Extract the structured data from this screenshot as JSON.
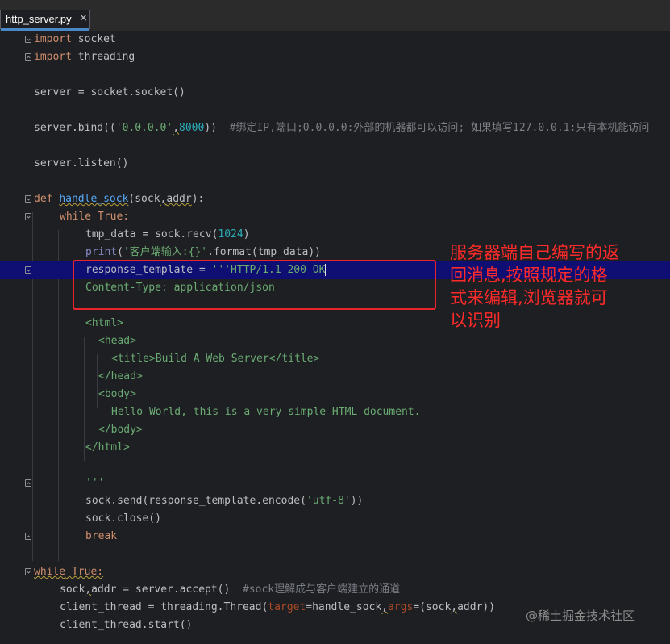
{
  "tab": {
    "filename": "http_server.py",
    "close_glyph": "×"
  },
  "code": {
    "l1": [
      "import",
      " socket"
    ],
    "l2": [
      "import",
      " threading"
    ],
    "l4": "server = socket.socket()",
    "l6": [
      "server.bind((",
      "'0.0.0.0'",
      ",",
      "8000",
      "))  ",
      "#绑定IP,端口;0.0.0.0:外部的机器都可以访问; 如果填写127.0.0.1:只有本机能访问"
    ],
    "l8": "server.listen()",
    "l10": [
      "def",
      " ",
      "handle_sock",
      "(sock",
      ",",
      "addr",
      "):"
    ],
    "l11": [
      "while",
      " True:"
    ],
    "l12": [
      "tmp_data = sock.recv(",
      "1024",
      ")"
    ],
    "l13": [
      "print",
      "(",
      "'客户端输入:{}'",
      ".format(tmp_data))"
    ],
    "l14": [
      "response_template = ",
      "'''HTTP/1.1 200 OK"
    ],
    "l15": "Content-Type: application/json",
    "l17": "<html>",
    "l18": "<head>",
    "l19": "<title>Build A Web Server</title>",
    "l20": "</head>",
    "l21": "<body>",
    "l22": "Hello World, this is a very simple HTML document.",
    "l23": "</body>",
    "l24": "</html>",
    "l26": "'''",
    "l27": [
      "sock.send(response_template.encode(",
      "'utf-8'",
      "))"
    ],
    "l28": "sock.close()",
    "l29": "break",
    "l31": [
      "while",
      " True:"
    ],
    "l32": [
      "sock",
      ",",
      "addr = server.accept()  ",
      "#sock理解成与客户端建立的通道"
    ],
    "l33": [
      "client_thread = threading.Thread(",
      "target",
      "=handle_sock",
      ",",
      "args",
      "=(sock",
      ",",
      "addr))"
    ],
    "l34": "client_thread.start()"
  },
  "annotation": {
    "text": "服务器端自己编写的返\n回消息,按照规定的格\n式来编辑,浏览器就可\n以识别"
  },
  "watermark": "@稀土掘金技术社区"
}
